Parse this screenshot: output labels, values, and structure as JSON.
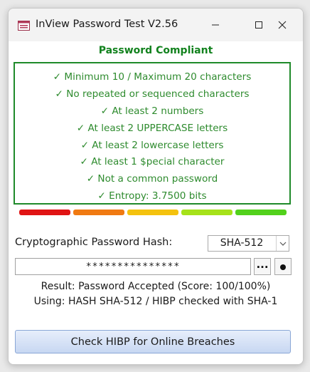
{
  "window": {
    "title": "InView Password Test V2.56",
    "icons": [
      "app-form-icon",
      "minimize-icon",
      "maximize-icon",
      "close-icon"
    ]
  },
  "status": {
    "label": "Password Compliant",
    "color": "#12821e"
  },
  "criteria": [
    "✓ Minimum 10 / Maximum 20 characters",
    "✓ No repeated or sequenced characters",
    "✓ At least 2 numbers",
    "✓ At least 2 UPPERCASE letters",
    "✓ At least 2 lowercase letters",
    "✓ At least 1 $pecial character",
    "✓ Not a common password",
    "✓ Entropy: 3.7500 bits"
  ],
  "strength_meter": {
    "segments_filled": 5,
    "segments_total": 5,
    "colors": [
      "#e01414",
      "#f07a12",
      "#f4c20e",
      "#a6e21a",
      "#52d11c"
    ]
  },
  "hash": {
    "label": "Cryptographic Password Hash:",
    "selected": "SHA-512"
  },
  "password": {
    "masked_value": "***************"
  },
  "buttons": {
    "browse_label": "...",
    "toggle_label": "●",
    "check_hibp_label": "Check HIBP for Online Breaches"
  },
  "result": {
    "line1": "Result: Password Accepted (Score: 100/100%)",
    "line2": "Using: HASH SHA-512 / HIBP checked with SHA-1"
  },
  "colors": {
    "accent_green": "#1f8a2a",
    "criteria_text": "#2e8b2e",
    "button_blue": "#c7d7f2"
  }
}
